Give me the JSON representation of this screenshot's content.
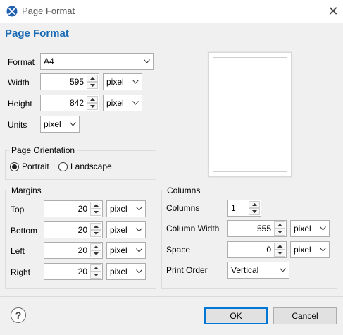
{
  "window": {
    "title": "Page Format",
    "close_glyph": "✕"
  },
  "header": {
    "heading": "Page Format"
  },
  "format": {
    "format_label": "Format",
    "format_value": "A4",
    "width_label": "Width",
    "width_value": "595",
    "width_unit": "pixel",
    "height_label": "Height",
    "height_value": "842",
    "height_unit": "pixel",
    "units_label": "Units",
    "units_value": "pixel"
  },
  "orientation": {
    "title": "Page Orientation",
    "portrait_label": "Portrait",
    "landscape_label": "Landscape",
    "selected": "Portrait"
  },
  "margins": {
    "title": "Margins",
    "top_label": "Top",
    "top_value": "20",
    "top_unit": "pixel",
    "bottom_label": "Bottom",
    "bottom_value": "20",
    "bottom_unit": "pixel",
    "left_label": "Left",
    "left_value": "20",
    "left_unit": "pixel",
    "right_label": "Right",
    "right_value": "20",
    "right_unit": "pixel"
  },
  "columns": {
    "title": "Columns",
    "columns_label": "Columns",
    "columns_value": "1",
    "column_width_label": "Column Width",
    "column_width_value": "555",
    "column_width_unit": "pixel",
    "space_label": "Space",
    "space_value": "0",
    "space_unit": "pixel",
    "print_order_label": "Print Order",
    "print_order_value": "Vertical"
  },
  "footer": {
    "help_glyph": "?",
    "ok_label": "OK",
    "cancel_label": "Cancel"
  },
  "colors": {
    "accent": "#1a6bb5",
    "dialog_bg": "#f0f0f0",
    "primary_border": "#0078d7"
  },
  "icons": [
    "app-logo-icon",
    "close-icon",
    "chevron-down-icon",
    "spin-up-icon",
    "spin-down-icon",
    "help-icon"
  ]
}
